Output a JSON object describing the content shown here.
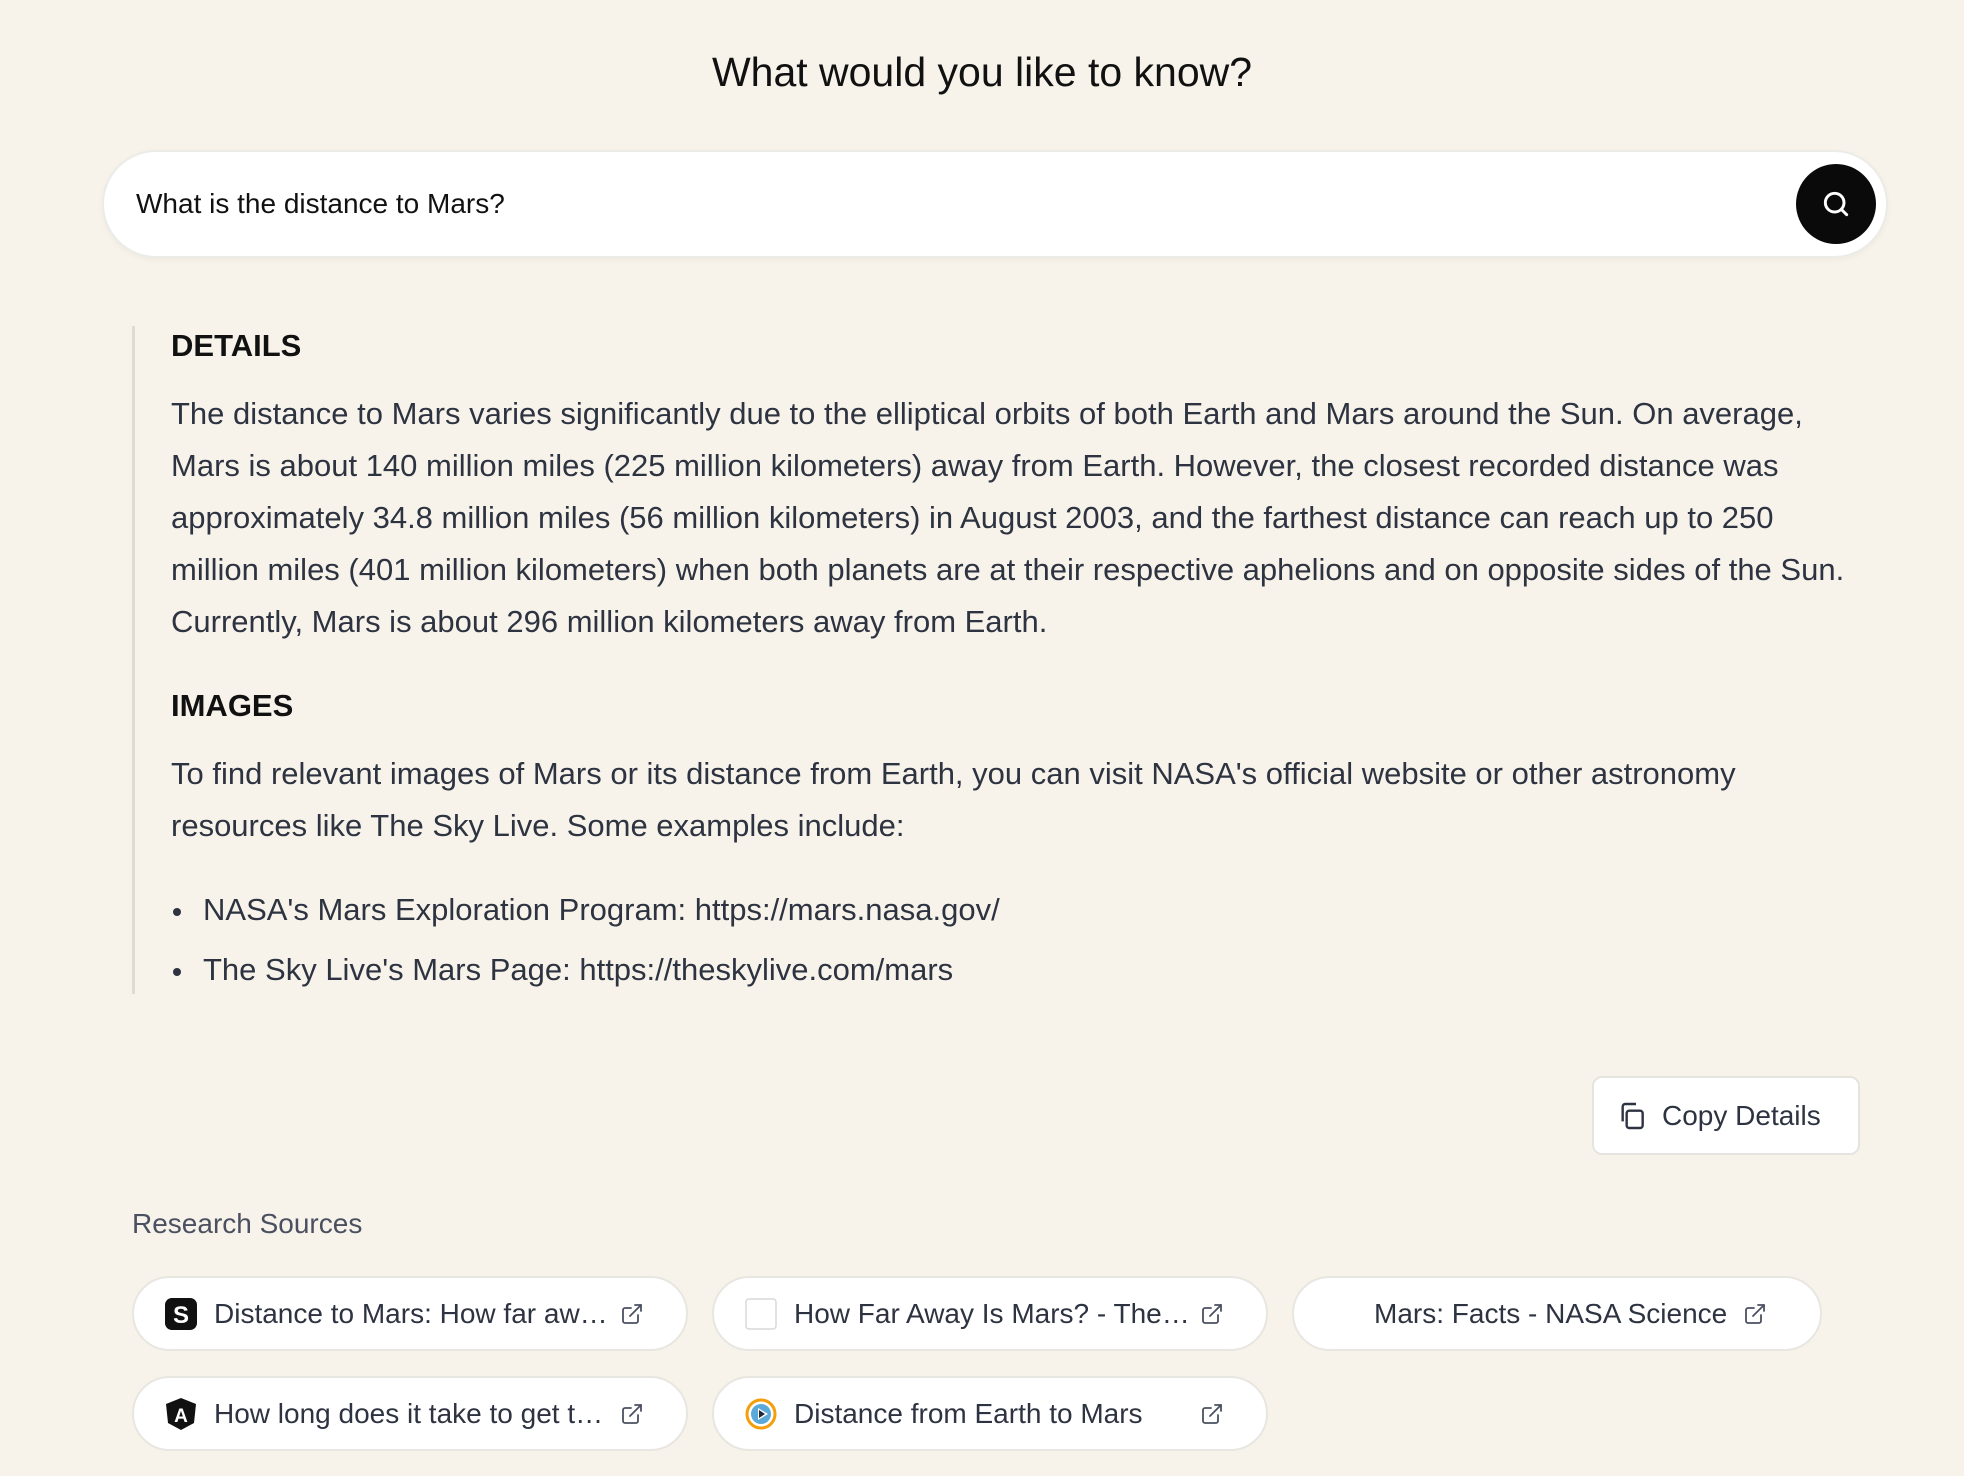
{
  "header": {
    "title": "What would you like to know?"
  },
  "search": {
    "value": "What is the distance to Mars?",
    "button_icon": "search-icon"
  },
  "answer": {
    "details_heading": "DETAILS",
    "details_text": "The distance to Mars varies significantly due to the elliptical orbits of both Earth and Mars around the Sun. On average, Mars is about 140 million miles (225 million kilometers) away from Earth. However, the closest recorded distance was approximately 34.8 million miles (56 million kilometers) in August 2003, and the farthest distance can reach up to 250 million miles (401 million kilometers) when both planets are at their respective aphelions and on opposite sides of the Sun. Currently, Mars is about 296 million kilometers away from Earth.",
    "images_heading": "IMAGES",
    "images_text": "To find relevant images of Mars or its distance from Earth, you can visit NASA's official website or other astronomy resources like The Sky Live. Some examples include:",
    "links": [
      "NASA's Mars Exploration Program: https://mars.nasa.gov/",
      "The Sky Live's Mars Page: https://theskylive.com/mars"
    ]
  },
  "actions": {
    "copy_label": "Copy Details",
    "copy_icon": "copy-icon"
  },
  "sources": {
    "heading": "Research Sources",
    "items": [
      {
        "label": "Distance to Mars: How far away is Mars?",
        "favicon": "s-logo-icon"
      },
      {
        "label": "How Far Away Is Mars? - The Planets",
        "favicon": "blank-favicon-icon"
      },
      {
        "label": "Mars: Facts - NASA Science",
        "favicon": "none"
      },
      {
        "label": "How long does it take to get to Mars?",
        "favicon": "a-shield-logo-icon"
      },
      {
        "label": "Distance from Earth to Mars",
        "favicon": "play-circle-logo-icon"
      }
    ]
  },
  "colors": {
    "background": "#f7f3ea",
    "search_button": "#0a0a0a",
    "text": "#2d3340"
  }
}
